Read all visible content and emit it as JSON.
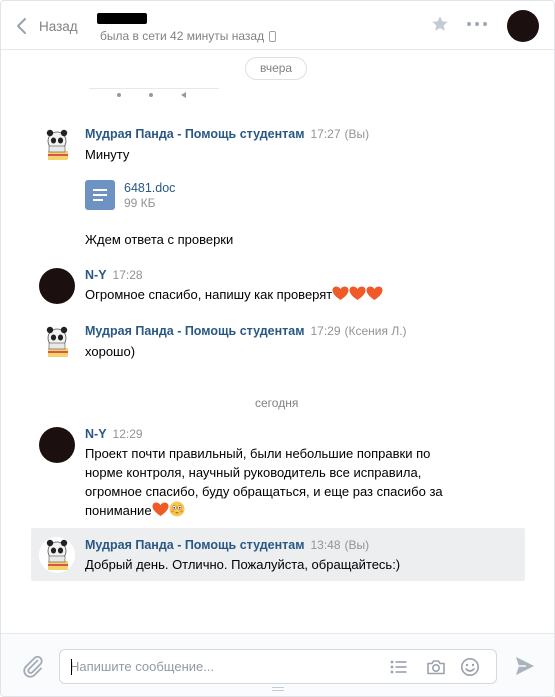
{
  "header": {
    "back_label": "Назад",
    "last_seen": "была в сети 42 минуты назад"
  },
  "chat": {
    "date_pill": "вчера",
    "today_label": "сегодня",
    "messages": [
      {
        "author": "Мудрая Панда - Помощь студентам",
        "time": "17:27",
        "suffix": "(Вы)",
        "text_1": "Минуту",
        "doc_name": "6481.doc",
        "doc_size": "99 КБ",
        "text_2": "Ждем ответа с проверки"
      },
      {
        "author": "N-Y",
        "time": "17:28",
        "text": "Огромное спасибо, напишу как проверят"
      },
      {
        "author": "Мудрая Панда - Помощь студентам",
        "time": "17:29",
        "suffix": "(Ксения Л.)",
        "text": "хорошо)"
      },
      {
        "author": "N-Y",
        "time": "12:29",
        "text": "Проект почти правильный, были небольшие поправки по норме контроля, научный руководитель все исправила, огромное спасибо, буду обращаться, и еще раз спасибо за понимание"
      },
      {
        "author": "Мудрая Панда - Помощь студентам",
        "time": "13:48",
        "suffix": "(Вы)",
        "text": "Добрый день. Отлично. Пожалуйста, обращайтесь:)"
      }
    ]
  },
  "composer": {
    "placeholder": "Напишите сообщение..."
  },
  "icons": {
    "back": "chevron-left-icon",
    "star": "star-icon",
    "more": "more-dots-icon",
    "attach": "paperclip-icon",
    "template": "list-icon",
    "camera": "camera-icon",
    "emoji": "smile-icon",
    "send": "send-icon"
  },
  "colors": {
    "link": "#2a5885",
    "muted": "#828282",
    "highlight": "#edeef0",
    "heart": "#f05a28"
  }
}
